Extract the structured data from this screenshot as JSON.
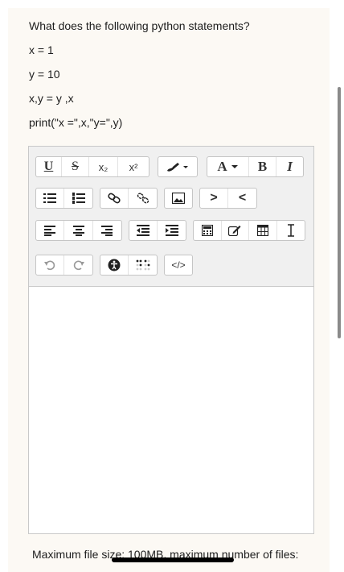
{
  "question": {
    "title": "What does the following python statements?",
    "lines": [
      "x = 1",
      "y = 10",
      "x,y = y ,x",
      "print(\"x =\",x,\"y=\",y)"
    ]
  },
  "toolbar": {
    "row1": [
      "underline",
      "strikethrough",
      "subscript",
      "superscript",
      "brush",
      "font-color",
      "bold",
      "italic"
    ],
    "subscript_label": "x₂",
    "superscript_label": "x²",
    "font_color_label": "A",
    "bold_label": "B",
    "italic_label": "I",
    "underline_label": "U",
    "strike_label": "S",
    "html_label": "</>",
    "indent_right_label": ">",
    "indent_left_label": "<"
  },
  "footer": {
    "text": "Maximum file size: 100MB, maximum number of files:"
  }
}
